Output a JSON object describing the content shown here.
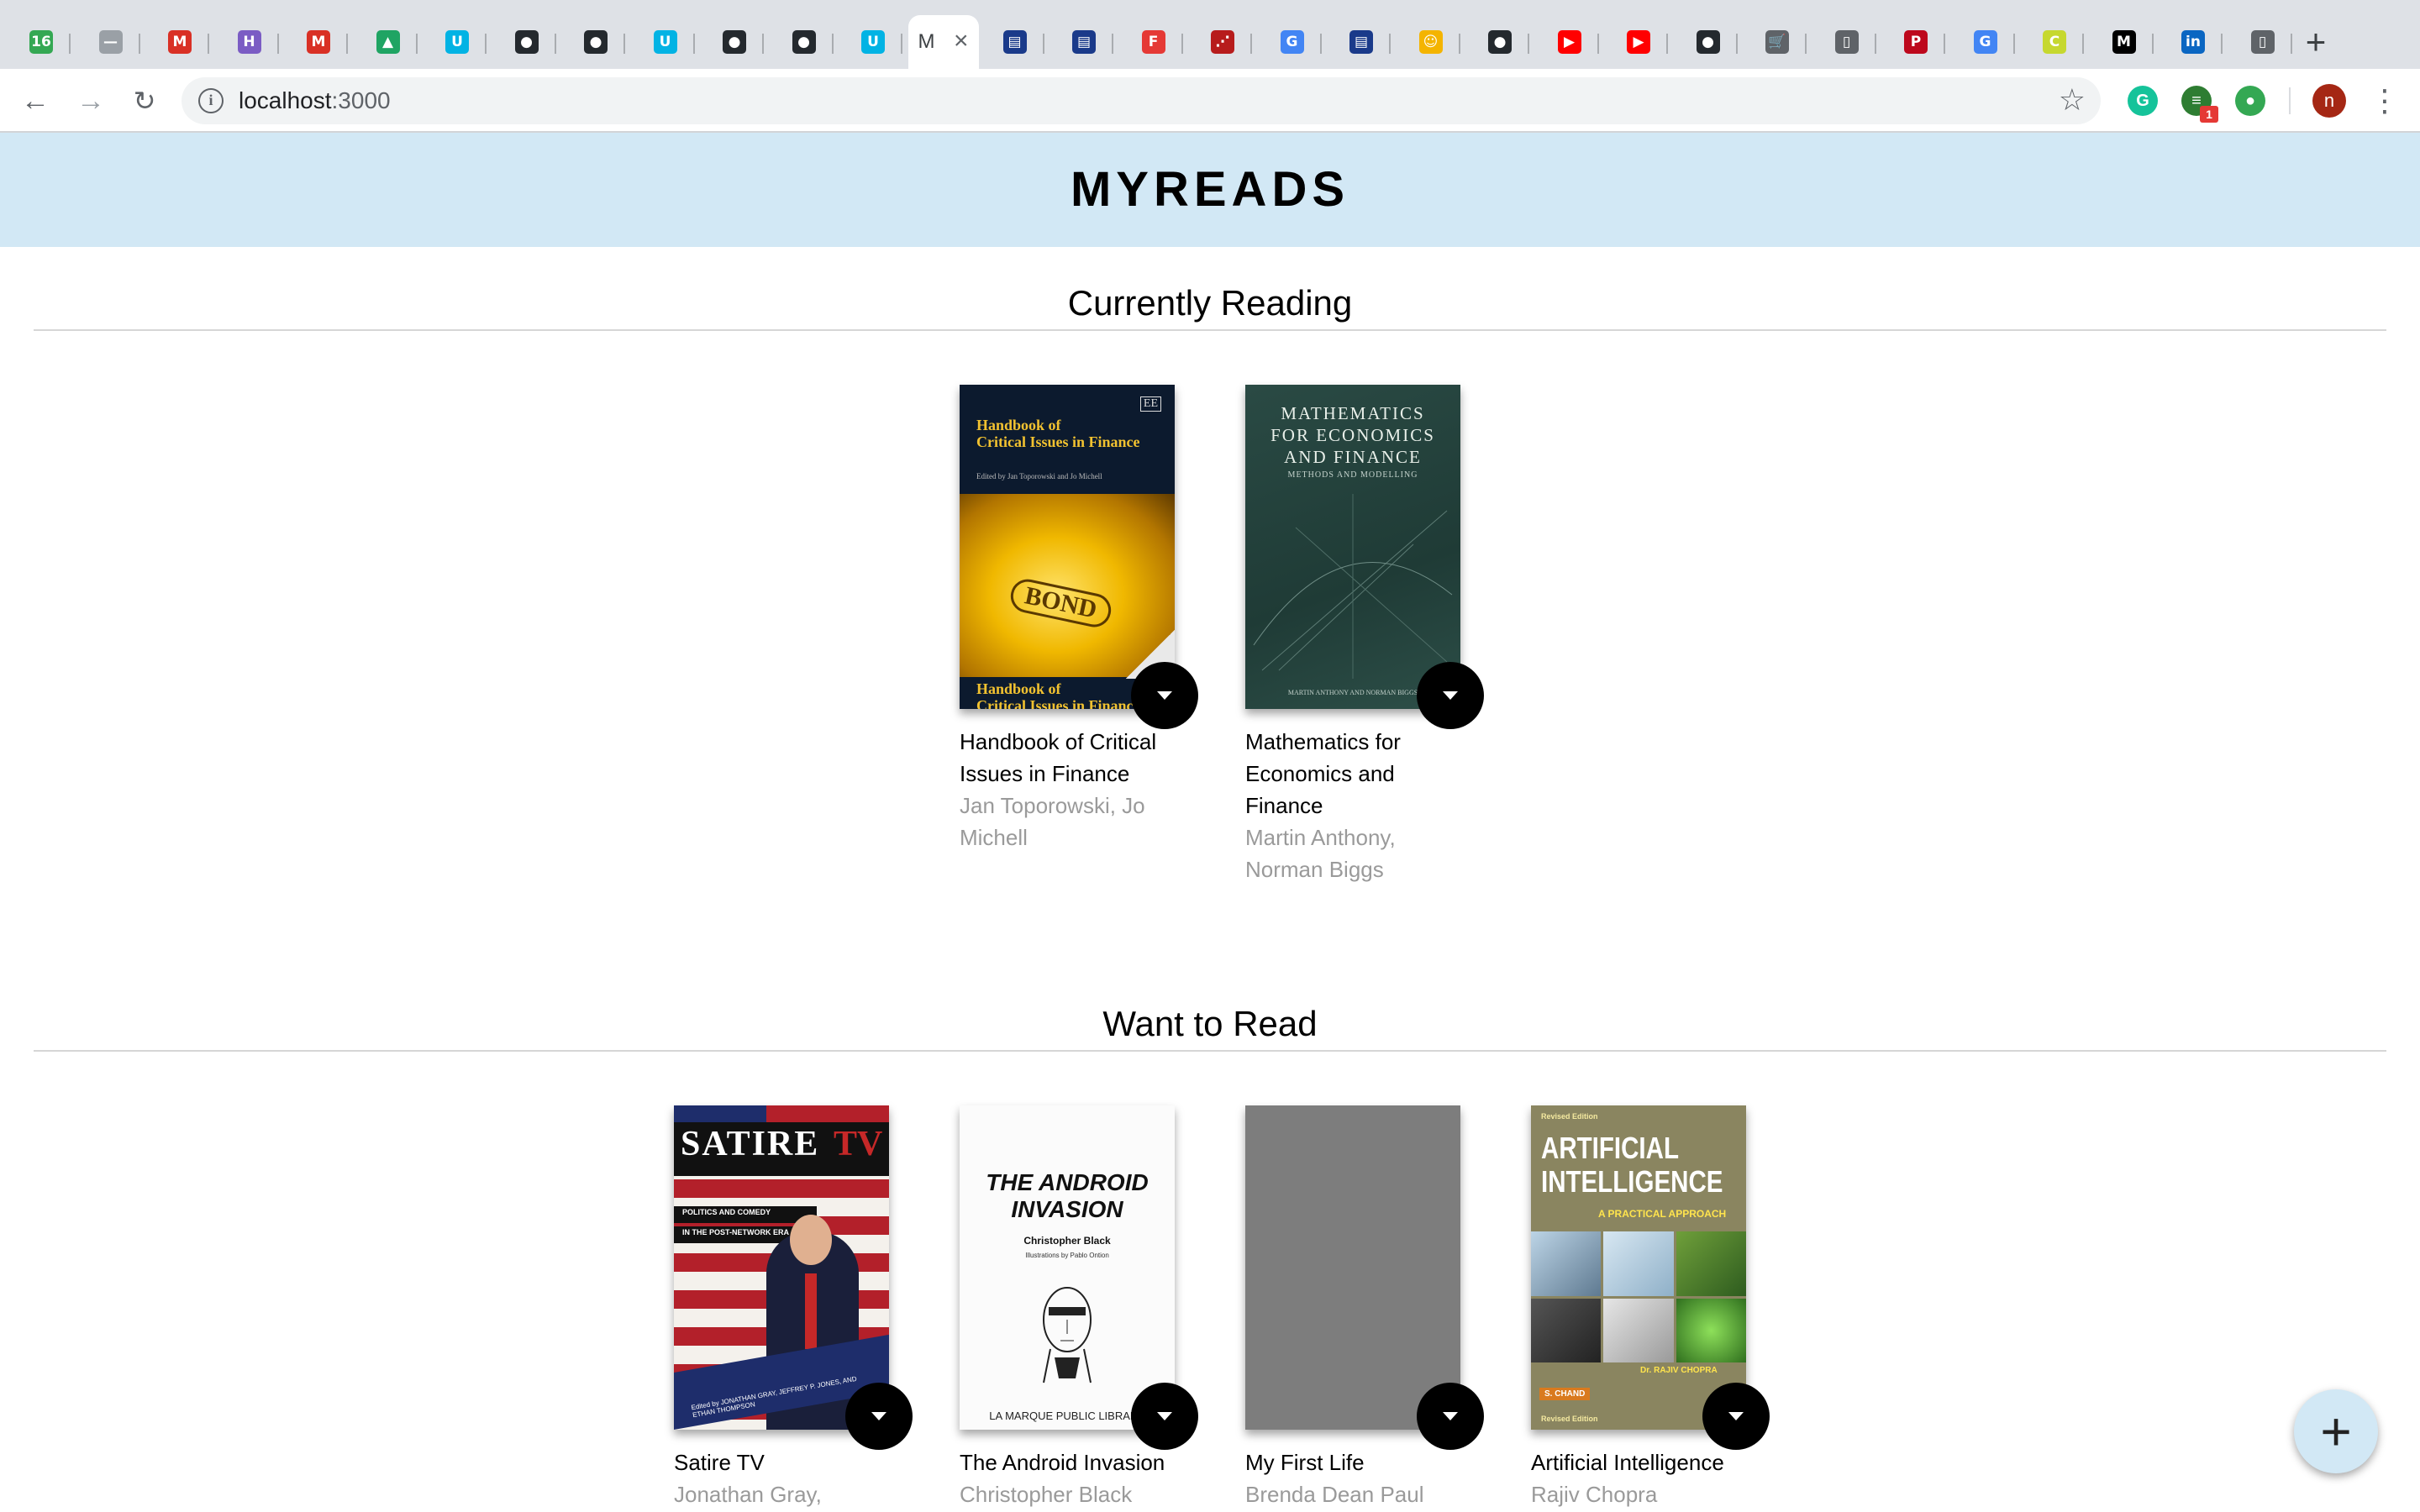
{
  "browser": {
    "tabs": [
      {
        "name": "tab-1",
        "icon": "counter-icon",
        "glyph": "16",
        "color": "#34a853"
      },
      {
        "name": "tab-2",
        "icon": "dash-icon",
        "glyph": "—",
        "color": "#9aa0a6"
      },
      {
        "name": "tab-3",
        "icon": "gmail-icon",
        "glyph": "M",
        "color": "#d93025"
      },
      {
        "name": "tab-4",
        "icon": "h-icon",
        "glyph": "H",
        "color": "#7b5cc4"
      },
      {
        "name": "tab-5",
        "icon": "gmail-icon",
        "glyph": "M",
        "color": "#d93025"
      },
      {
        "name": "tab-6",
        "icon": "drive-icon",
        "glyph": "▲",
        "color": "#1fa463"
      },
      {
        "name": "tab-7",
        "icon": "udacity-icon",
        "glyph": "U",
        "color": "#02b3e4"
      },
      {
        "name": "tab-8",
        "icon": "github-icon",
        "glyph": "●",
        "color": "#24292e"
      },
      {
        "name": "tab-9",
        "icon": "github-icon",
        "glyph": "●",
        "color": "#24292e"
      },
      {
        "name": "tab-10",
        "icon": "udacity-icon",
        "glyph": "U",
        "color": "#02b3e4"
      },
      {
        "name": "tab-11",
        "icon": "github-icon",
        "glyph": "●",
        "color": "#24292e"
      },
      {
        "name": "tab-12",
        "icon": "github-icon",
        "glyph": "●",
        "color": "#24292e"
      },
      {
        "name": "tab-13",
        "icon": "udacity-icon",
        "glyph": "U",
        "color": "#02b3e4"
      }
    ],
    "active_tab": {
      "title": "M",
      "close": "×"
    },
    "tabs_after": [
      {
        "name": "tab-15",
        "icon": "api-icon",
        "glyph": "▤",
        "color": "#1a3a8a"
      },
      {
        "name": "tab-16",
        "icon": "api-icon",
        "glyph": "▤",
        "color": "#1a3a8a"
      },
      {
        "name": "tab-17",
        "icon": "f-icon",
        "glyph": "F",
        "color": "#e53935"
      },
      {
        "name": "tab-18",
        "icon": "dots-icon",
        "glyph": "⋰",
        "color": "#b71c1c"
      },
      {
        "name": "tab-19",
        "icon": "google-icon",
        "glyph": "G",
        "color": "#4285f4"
      },
      {
        "name": "tab-20",
        "icon": "api-icon",
        "glyph": "▤",
        "color": "#1a3a8a"
      },
      {
        "name": "tab-21",
        "icon": "smile-icon",
        "glyph": "☺",
        "color": "#f4b400"
      },
      {
        "name": "tab-22",
        "icon": "github-icon",
        "glyph": "●",
        "color": "#24292e"
      },
      {
        "name": "tab-23",
        "icon": "youtube-icon",
        "glyph": "▶",
        "color": "#ff0000"
      },
      {
        "name": "tab-24",
        "icon": "youtube-icon",
        "glyph": "▶",
        "color": "#ff0000"
      },
      {
        "name": "tab-25",
        "icon": "github-icon",
        "glyph": "●",
        "color": "#24292e"
      },
      {
        "name": "tab-26",
        "icon": "cart-icon",
        "glyph": "🛒",
        "color": "#5f6368"
      },
      {
        "name": "tab-27",
        "icon": "page-icon",
        "glyph": "▯",
        "color": "#5f6368"
      },
      {
        "name": "tab-28",
        "icon": "pinterest-icon",
        "glyph": "P",
        "color": "#bd081c"
      },
      {
        "name": "tab-29",
        "icon": "google-icon",
        "glyph": "G",
        "color": "#4285f4"
      },
      {
        "name": "tab-30",
        "icon": "c-icon",
        "glyph": "C",
        "color": "#c6d82f"
      },
      {
        "name": "tab-31",
        "icon": "medium-icon",
        "glyph": "M",
        "color": "#000000"
      },
      {
        "name": "tab-32",
        "icon": "linkedin-icon",
        "glyph": "in",
        "color": "#0a66c2"
      },
      {
        "name": "tab-33",
        "icon": "page-icon",
        "glyph": "▯",
        "color": "#5f6368"
      }
    ],
    "new_tab": "+",
    "url_host": "localhost",
    "url_port": ":3000",
    "ext_badge": "1",
    "avatar_letter": "n"
  },
  "app": {
    "title": "MYREADS",
    "shelves": [
      {
        "title": "Currently Reading",
        "books": [
          {
            "title": "Handbook of Critical Issues in Finance",
            "authors": "Jan Toporowski, Jo Michell",
            "cover": "handbook"
          },
          {
            "title": "Mathematics for Economics and Finance",
            "authors": "Martin Anthony, Norman Biggs",
            "cover": "math"
          }
        ]
      },
      {
        "title": "Want to Read",
        "books": [
          {
            "title": "Satire TV",
            "authors": "Jonathan Gray, Jeffrey",
            "cover": "satire"
          },
          {
            "title": "The Android Invasion",
            "authors": "Christopher Black",
            "cover": "android"
          },
          {
            "title": "My First Life",
            "authors": "Brenda Dean Paul",
            "cover": "blank"
          },
          {
            "title": "Artificial Intelligence",
            "authors": "Rajiv Chopra",
            "cover": "ai"
          }
        ]
      }
    ],
    "covers": {
      "handbook": {
        "top": "Handbook of",
        "top2": "Critical Issues in Finance",
        "sub": "Edited by Jan Toporowski and Jo Michell",
        "badge": "EE",
        "bond": "BOND",
        "bottom": "Handbook of",
        "bottom2": "Critical Issues in Finance"
      },
      "math": {
        "l1": "MATHEMATICS",
        "l2": "FOR ECONOMICS",
        "l3": "AND FINANCE",
        "l4": "METHODS AND MODELLING",
        "l5": "MARTIN ANTHONY AND NORMAN BIGGS"
      },
      "satire": {
        "l1": "SATIRE",
        "l2": "TV",
        "l3": "POLITICS AND COMEDY",
        "l4": "IN THE POST-NETWORK ERA",
        "l5": "Edited by JONATHAN GRAY, JEFFREY P. JONES, AND ETHAN THOMPSON"
      },
      "android": {
        "l1": "THE ANDROID",
        "l2": "INVASION",
        "l3": "Christopher Black",
        "l4": "Illustrations by Pablo Ontion",
        "l5": "LA MARQUE PUBLIC LIBRARY"
      },
      "ai": {
        "l0": "Revised Edition",
        "l1": "ARTIFICIAL",
        "l2": "INTELLIGENCE",
        "l3": "A PRACTICAL APPROACH",
        "l4": "Dr. RAJIV CHOPRA",
        "l5": "S. CHAND",
        "l6": "Revised Edition"
      }
    },
    "changer_icon": "caret-down-icon",
    "fab_label": "+"
  }
}
